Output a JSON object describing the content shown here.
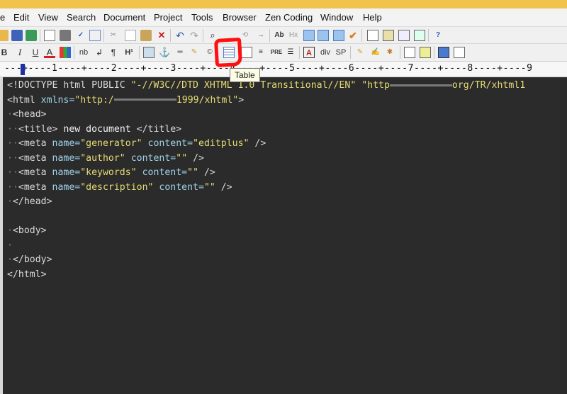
{
  "menu": [
    "e",
    "Edit",
    "View",
    "Search",
    "Document",
    "Project",
    "Tools",
    "Browser",
    "Zen Coding",
    "Window",
    "Help"
  ],
  "toolbar2": {
    "bold": "B",
    "italic": "I",
    "underline": "U",
    "font_color": "A",
    "nbsp": "nb",
    "br": "↲",
    "para": "¶",
    "heading": "H¹",
    "pre": "PRE",
    "div": "div",
    "span": "SP",
    "tt": "Ab",
    "hx": "Hx"
  },
  "ruler": {
    "text": "---+----1----+----2----+----3----+----4----+----5----+----6----+----7----+----8----+----9"
  },
  "tooltip": "Table",
  "code": {
    "doctype_kw": "<!DOCTYPE html PUBLIC ",
    "doctype_str1": "\"-//W3C//DTD XHTML 1.0 Transitional//EN\"",
    "doctype_str2a": "\"http",
    "doctype_str2b": "org/TR/xhtml1",
    "html_open": "<html ",
    "xmlns_attr": "xmlns=",
    "xmlns_val_a": "\"http:/",
    "xmlns_val_b": "1999/xhtml\"",
    "gt": ">",
    "head_open": "<head>",
    "title_open": "<title>",
    "title_text": "new document",
    "title_close": "</title>",
    "meta1_a": "<meta ",
    "name_attr": "name=",
    "content_attr": "content=",
    "gen_val": "\"generator\"",
    "editplus_val": "\"editplus\"",
    "author_val": "\"author\"",
    "keywords_val": "\"keywords\"",
    "description_val": "\"description\"",
    "empty_val": "\"\"",
    "selfclose": "/>",
    "head_close": "</head>",
    "body_open": "<body>",
    "body_close": "</body>",
    "html_close": "</html>"
  },
  "colors": {
    "annotation": "#ff1010",
    "editor_bg": "#2b2b2b",
    "tag": "#d8d8d8",
    "attr": "#9fd3ea",
    "string": "#e6db74"
  }
}
